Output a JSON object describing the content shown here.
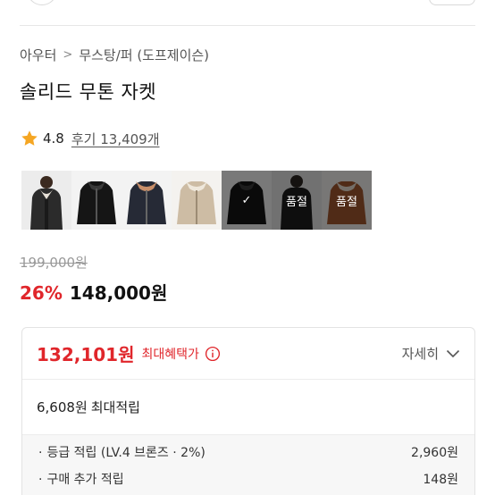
{
  "breadcrumb": {
    "category": "아우터",
    "subcategory": "무스탕/퍼 (도프제이슨)"
  },
  "product": {
    "title": "솔리드 무톤 자켓",
    "rating": "4.8",
    "reviews": "후기 13,409개"
  },
  "thumbnails": [
    {
      "name": "thumb-model-jacket",
      "overlay": ""
    },
    {
      "name": "thumb-black-jacket",
      "overlay": ""
    },
    {
      "name": "thumb-navy-jacket",
      "overlay": ""
    },
    {
      "name": "thumb-beige-jacket",
      "overlay": ""
    },
    {
      "name": "thumb-black-selected",
      "overlay": "✓"
    },
    {
      "name": "thumb-soldout-1",
      "overlay": "품절"
    },
    {
      "name": "thumb-soldout-2",
      "overlay": "품절"
    }
  ],
  "pricing": {
    "original": "199,000원",
    "discount": "26%",
    "price": "148,000원"
  },
  "benefit": {
    "max_price": "132,101원",
    "max_label": "최대혜택가",
    "detail_label": "자세히",
    "points_amount": "6,608원",
    "points_label": "최대적립",
    "rows": [
      {
        "label": "등급 적립 (LV.4 브론즈 · 2%)",
        "value": "2,960원"
      },
      {
        "label": "구매 추가 적립",
        "value": "148원"
      }
    ]
  },
  "colors": {
    "accent_red": "#e0262b",
    "star": "#f5a623"
  }
}
